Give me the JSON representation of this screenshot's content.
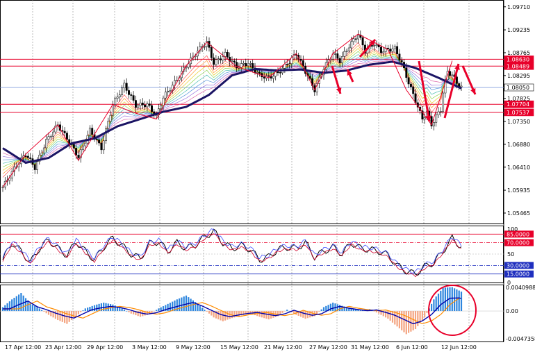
{
  "colors": {
    "background": "#ffffff",
    "grid": "#8a8a8a",
    "candle": "#000000",
    "resistance": "#e8002a",
    "current_price": "#6e8bd6",
    "current_tag_fill": "#ffffff",
    "current_tag_text": "#000000",
    "ema_thick": "#1b1464",
    "drawings": "#e8002a",
    "rsi_black": "#000000",
    "rsi_blue": "#3d4cff",
    "rsi_red": "#d0002a",
    "rsi_level_high": "#e8002a",
    "rsi_level_low": "#1f2fbf",
    "macd_pos": "#2e86de",
    "macd_neg": "#f4a582",
    "macd_signal": "#ff8c00",
    "macd_line": "#0000aa",
    "circle": "#e8002a"
  },
  "chart_data": [
    {
      "type": "candlestick",
      "title": "",
      "x_tick_labels": [
        "17 Apr 12:00",
        "23 Apr 12:00",
        "29 Apr 12:00",
        "3 May 12:00",
        "9 May 12:00",
        "15 May 12:00",
        "21 May 12:00",
        "27 May 12:00",
        "31 May 12:00",
        "6 Jun 12:00",
        "12 Jun 12:00"
      ],
      "y_tick_labels": [
        "1.09710",
        "1.09235",
        "1.08765",
        "1.08295",
        "1.07825",
        "1.07350",
        "1.06880",
        "1.06410",
        "1.05935",
        "1.05465"
      ],
      "ylim": [
        1.0525,
        1.0985
      ],
      "horizontal_levels": [
        {
          "value": 1.0863,
          "label": "1.08630",
          "role": "resistance"
        },
        {
          "value": 1.08489,
          "label": "1.08489",
          "role": "resistance"
        },
        {
          "value": 1.0805,
          "label": "1.08050",
          "role": "current"
        },
        {
          "value": 1.07704,
          "label": "1.07704",
          "role": "support"
        },
        {
          "value": 1.07537,
          "label": "1.07537",
          "role": "support"
        }
      ],
      "price_path": [
        [
          0,
          1.06
        ],
        [
          6,
          1.0645
        ],
        [
          10,
          1.0668
        ],
        [
          14,
          1.064
        ],
        [
          19,
          1.0695
        ],
        [
          24,
          1.0728
        ],
        [
          28,
          1.07
        ],
        [
          33,
          1.0662
        ],
        [
          38,
          1.0717
        ],
        [
          43,
          1.068
        ],
        [
          48,
          1.077
        ],
        [
          53,
          1.081
        ],
        [
          58,
          1.0768
        ],
        [
          63,
          1.077
        ],
        [
          67,
          1.0745
        ],
        [
          70,
          1.0785
        ],
        [
          75,
          1.0815
        ],
        [
          80,
          1.085
        ],
        [
          85,
          1.088
        ],
        [
          89,
          1.0898
        ],
        [
          92,
          1.0855
        ],
        [
          97,
          1.0873
        ],
        [
          102,
          1.0848
        ],
        [
          107,
          1.0855
        ],
        [
          112,
          1.083
        ],
        [
          116,
          1.0825
        ],
        [
          120,
          1.0835
        ],
        [
          125,
          1.0858
        ],
        [
          128,
          1.0875
        ],
        [
          132,
          1.0838
        ],
        [
          136,
          1.08
        ],
        [
          140,
          1.0845
        ],
        [
          144,
          1.0875
        ],
        [
          147,
          1.086
        ],
        [
          151,
          1.089
        ],
        [
          155,
          1.0915
        ],
        [
          158,
          1.088
        ],
        [
          162,
          1.0895
        ],
        [
          165,
          1.088
        ],
        [
          168,
          1.0883
        ],
        [
          171,
          1.0885
        ],
        [
          174,
          1.0855
        ],
        [
          177,
          1.0815
        ],
        [
          180,
          1.0778
        ],
        [
          183,
          1.074
        ],
        [
          185,
          1.0755
        ],
        [
          187,
          1.0728
        ],
        [
          189,
          1.0745
        ],
        [
          191,
          1.076
        ],
        [
          192,
          1.0795
        ],
        [
          194,
          1.0838
        ],
        [
          196,
          1.083
        ],
        [
          198,
          1.0815
        ],
        [
          200,
          1.0805
        ]
      ],
      "ma_thick": [
        [
          0,
          1.068
        ],
        [
          10,
          1.065
        ],
        [
          20,
          1.066
        ],
        [
          30,
          1.069
        ],
        [
          40,
          1.07
        ],
        [
          50,
          1.0725
        ],
        [
          60,
          1.074
        ],
        [
          70,
          1.0755
        ],
        [
          80,
          1.0765
        ],
        [
          90,
          1.079
        ],
        [
          100,
          1.083
        ],
        [
          110,
          1.0843
        ],
        [
          120,
          1.084
        ],
        [
          130,
          1.0842
        ],
        [
          140,
          1.0835
        ],
        [
          150,
          1.084
        ],
        [
          160,
          1.0852
        ],
        [
          170,
          1.0858
        ],
        [
          180,
          1.0845
        ],
        [
          190,
          1.0825
        ],
        [
          200,
          1.0803
        ]
      ]
    },
    {
      "type": "line",
      "title": "",
      "y_tick_labels": [
        "100",
        "50",
        "0"
      ],
      "ylim": [
        0,
        100
      ],
      "levels": [
        {
          "value": 85,
          "label": "85.0000",
          "role": "high"
        },
        {
          "value": 70,
          "label": "70.0000",
          "role": "high"
        },
        {
          "value": 30,
          "label": "30.0000",
          "role": "low"
        },
        {
          "value": 15,
          "label": "15.0000",
          "role": "low"
        }
      ],
      "series": [
        {
          "values_x": [
            0,
            4,
            8,
            12,
            16,
            20,
            24,
            28,
            32,
            36,
            40,
            44,
            48,
            52,
            56,
            60,
            64,
            68,
            72,
            76,
            80,
            84,
            88,
            92,
            96,
            100,
            104,
            108,
            112,
            116,
            120,
            124,
            128,
            132,
            136,
            140,
            144,
            148,
            152,
            156,
            160,
            164,
            168,
            172,
            176,
            180,
            184,
            188,
            192,
            196,
            200
          ],
          "values": [
            40,
            70,
            55,
            35,
            60,
            75,
            60,
            48,
            72,
            55,
            40,
            62,
            78,
            65,
            50,
            42,
            68,
            72,
            55,
            70,
            60,
            66,
            80,
            90,
            70,
            60,
            65,
            58,
            40,
            45,
            58,
            62,
            60,
            70,
            45,
            55,
            62,
            50,
            70,
            60,
            58,
            55,
            48,
            30,
            20,
            15,
            28,
            35,
            55,
            78,
            62
          ]
        }
      ]
    },
    {
      "type": "bar",
      "title": "",
      "y_tick_labels": [
        "0.0040988",
        "0.00",
        "-0.0047358"
      ],
      "ylim": [
        -0.0047358,
        0.0040988
      ],
      "note_values": [
        [
          0,
          0.0006
        ],
        [
          4,
          0.0018
        ],
        [
          8,
          0.0028
        ],
        [
          12,
          0.0012
        ],
        [
          16,
          0.0004
        ],
        [
          20,
          -0.0006
        ],
        [
          24,
          -0.0014
        ],
        [
          28,
          -0.002
        ],
        [
          32,
          -0.0008
        ],
        [
          36,
          0.0004
        ],
        [
          40,
          0.0009
        ],
        [
          44,
          0.0013
        ],
        [
          48,
          0.001
        ],
        [
          52,
          0.0004
        ],
        [
          56,
          -0.0004
        ],
        [
          60,
          -0.0009
        ],
        [
          64,
          -0.0005
        ],
        [
          68,
          0.0004
        ],
        [
          72,
          0.0011
        ],
        [
          76,
          0.0018
        ],
        [
          80,
          0.0024
        ],
        [
          84,
          0.0014
        ],
        [
          88,
          0.0002
        ],
        [
          92,
          -0.001
        ],
        [
          96,
          -0.0016
        ],
        [
          100,
          -0.0011
        ],
        [
          104,
          -0.0007
        ],
        [
          108,
          -0.0004
        ],
        [
          112,
          -0.0009
        ],
        [
          116,
          -0.0013
        ],
        [
          120,
          -0.0008
        ],
        [
          124,
          0.0002
        ],
        [
          128,
          -0.0006
        ],
        [
          132,
          -0.0012
        ],
        [
          136,
          -0.0008
        ],
        [
          140,
          0.0006
        ],
        [
          144,
          0.0013
        ],
        [
          148,
          0.0008
        ],
        [
          152,
          0.0004
        ],
        [
          156,
          0.0001
        ],
        [
          160,
          0.0003
        ],
        [
          164,
          -0.0004
        ],
        [
          168,
          -0.0012
        ],
        [
          172,
          -0.0024
        ],
        [
          176,
          -0.0036
        ],
        [
          180,
          -0.0028
        ],
        [
          184,
          -0.001
        ],
        [
          188,
          0.0018
        ],
        [
          192,
          0.0036
        ],
        [
          196,
          0.0037
        ],
        [
          200,
          0.003
        ]
      ]
    }
  ]
}
